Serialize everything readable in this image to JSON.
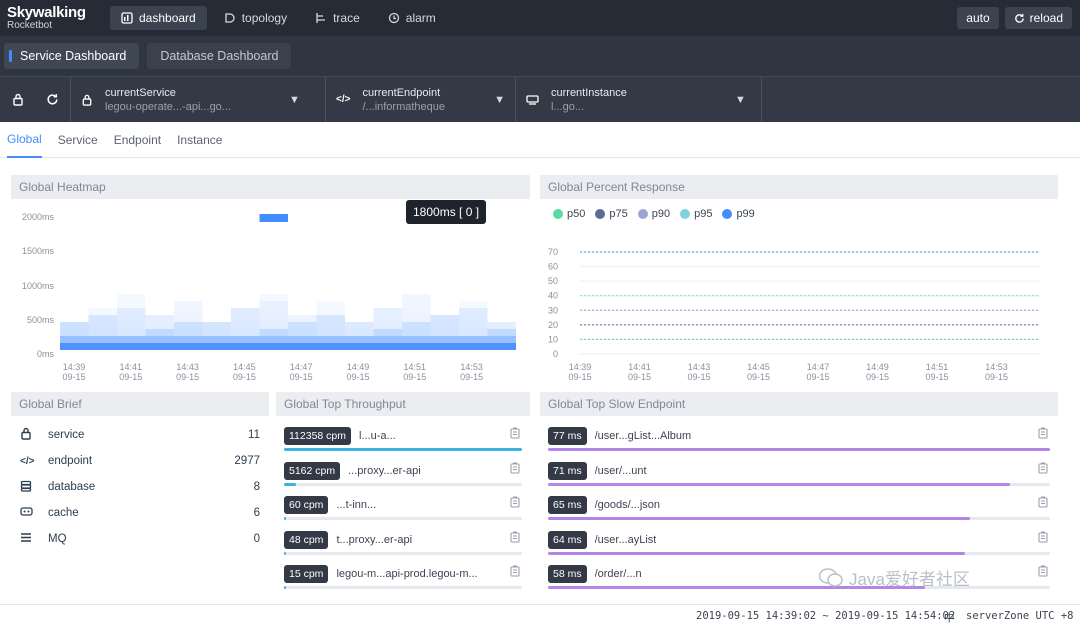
{
  "app": {
    "logo_line1": "Skywalking",
    "logo_line2": "Rocketbot"
  },
  "nav": [
    {
      "label": "dashboard",
      "icon": "dashboard-icon",
      "active": true
    },
    {
      "label": "topology",
      "icon": "topology-icon",
      "active": false
    },
    {
      "label": "trace",
      "icon": "trace-icon",
      "active": false
    },
    {
      "label": "alarm",
      "icon": "alarm-icon",
      "active": false
    }
  ],
  "toolbar": {
    "auto_label": "auto",
    "reload_label": "reload"
  },
  "dashboards": [
    {
      "label": "Service Dashboard",
      "active": true
    },
    {
      "label": "Database Dashboard",
      "active": false
    }
  ],
  "selectors": [
    {
      "label": "currentService",
      "value": "legou-operate...-api...go..."
    },
    {
      "label": "currentEndpoint",
      "value": "/...informatheque"
    },
    {
      "label": "currentInstance",
      "value": "l...go..."
    }
  ],
  "tabs": [
    {
      "label": "Global",
      "active": true
    },
    {
      "label": "Service",
      "active": false
    },
    {
      "label": "Endpoint",
      "active": false
    },
    {
      "label": "Instance",
      "active": false
    }
  ],
  "heatmap": {
    "title": "Global Heatmap",
    "y_ticks": [
      "2000ms",
      "1500ms",
      "1000ms",
      "500ms",
      "0ms"
    ],
    "x_ticks": [
      [
        "14:39",
        "09-15"
      ],
      [
        "14:41",
        "09-15"
      ],
      [
        "14:43",
        "09-15"
      ],
      [
        "14:45",
        "09-15"
      ],
      [
        "14:47",
        "09-15"
      ],
      [
        "14:49",
        "09-15"
      ],
      [
        "14:51",
        "09-15"
      ],
      [
        "14:53",
        "09-15"
      ]
    ],
    "tooltip": "1800ms [ 0 ]"
  },
  "chart_data": {
    "type": "line",
    "title": "Global Percent Response",
    "legend": [
      "p50",
      "p75",
      "p90",
      "p95",
      "p99"
    ],
    "series_colors": [
      "#5ad8a6",
      "#5b6d95",
      "#9aa4d6",
      "#7fd3e0",
      "#448dfe"
    ],
    "y_ticks": [
      0,
      10,
      20,
      30,
      40,
      50,
      60,
      70
    ],
    "ylim": [
      0,
      70
    ],
    "x_ticks": [
      [
        "14:39",
        "09-15"
      ],
      [
        "14:41",
        "09-15"
      ],
      [
        "14:43",
        "09-15"
      ],
      [
        "14:45",
        "09-15"
      ],
      [
        "14:47",
        "09-15"
      ],
      [
        "14:49",
        "09-15"
      ],
      [
        "14:51",
        "09-15"
      ],
      [
        "14:53",
        "09-15"
      ]
    ],
    "series": [
      {
        "name": "p50",
        "values": [
          10,
          10,
          10,
          10,
          10,
          10,
          10,
          10
        ]
      },
      {
        "name": "p75",
        "values": [
          20,
          20,
          20,
          20,
          20,
          20,
          20,
          20
        ]
      },
      {
        "name": "p90",
        "values": [
          30,
          30,
          30,
          30,
          30,
          30,
          30,
          30
        ]
      },
      {
        "name": "p95",
        "values": [
          40,
          40,
          40,
          40,
          40,
          40,
          40,
          40
        ]
      },
      {
        "name": "p99",
        "values": [
          70,
          70,
          70,
          70,
          70,
          70,
          70,
          70
        ]
      }
    ]
  },
  "brief": {
    "title": "Global Brief",
    "items": [
      {
        "label": "service",
        "count": "11",
        "icon": "lock-icon"
      },
      {
        "label": "endpoint",
        "count": "2977",
        "icon": "code-icon"
      },
      {
        "label": "database",
        "count": "8",
        "icon": "database-icon"
      },
      {
        "label": "cache",
        "count": "6",
        "icon": "cache-icon"
      },
      {
        "label": "MQ",
        "count": "0",
        "icon": "mq-icon"
      }
    ]
  },
  "throughput": {
    "title": "Global Top Throughput",
    "items": [
      {
        "badge": "112358 cpm",
        "label": "l...u-a...",
        "fill": 1.0
      },
      {
        "badge": "5162 cpm",
        "label": "...proxy...er-api",
        "fill": 0.05
      },
      {
        "badge": "60 cpm",
        "label": "...t-inn...",
        "fill": 0.01
      },
      {
        "badge": "48 cpm",
        "label": "t...proxy...er-api",
        "fill": 0.01
      },
      {
        "badge": "15 cpm",
        "label": "legou-m...api-prod.legou-m...",
        "fill": 0.005
      }
    ]
  },
  "slow": {
    "title": "Global Top Slow Endpoint",
    "items": [
      {
        "badge": "77 ms",
        "label": "/user...gList...Album",
        "fill": 1.0
      },
      {
        "badge": "71 ms",
        "label": "/user/...unt",
        "fill": 0.92
      },
      {
        "badge": "65 ms",
        "label": "/goods/...json",
        "fill": 0.84
      },
      {
        "badge": "64 ms",
        "label": "/user...ayList",
        "fill": 0.83
      },
      {
        "badge": "58 ms",
        "label": "/order/...n",
        "fill": 0.75
      }
    ]
  },
  "footer": {
    "range": "2019-09-15 14:39:02 ~ 2019-09-15 14:54:02",
    "lang": "中",
    "zone": "serverZone UTC +8"
  },
  "watermark": "Java爱好者社区"
}
